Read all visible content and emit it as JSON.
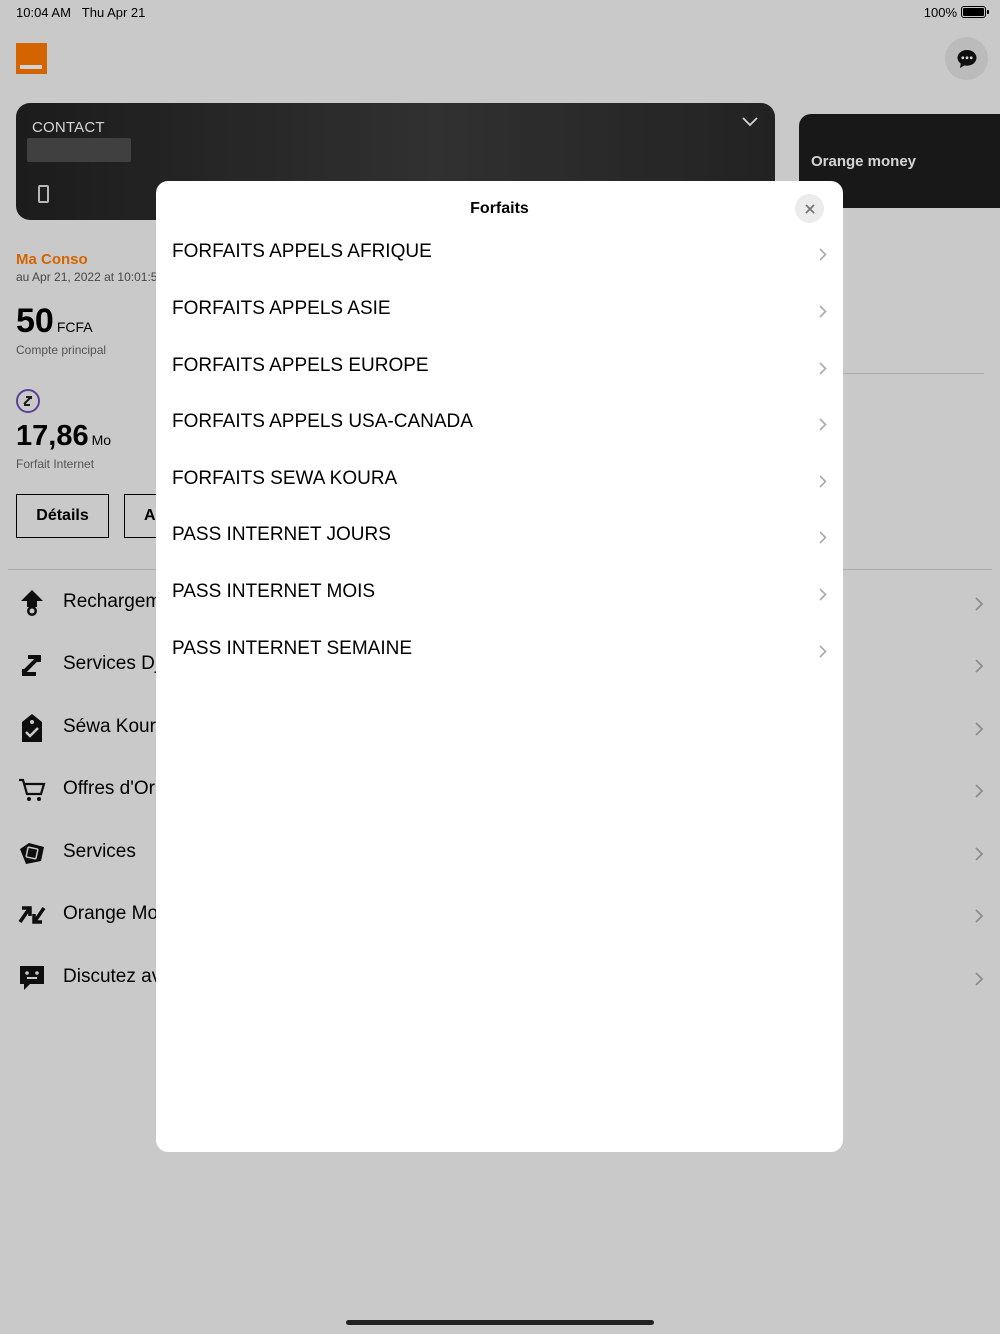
{
  "status_bar": {
    "time": "10:04 AM",
    "date": "Thu Apr 21",
    "battery": "100%"
  },
  "colors": {
    "brand_orange": "#ff7900",
    "djamo_purple": "#6e4fb4"
  },
  "header": {
    "logo_icon": "orange-logo",
    "chat_icon": "chat-bubble-icon"
  },
  "contact_card": {
    "label": "CONTACT"
  },
  "orange_money_card": {
    "label": "Orange money"
  },
  "conso": {
    "title": "Ma Conso",
    "date": "au Apr 21, 2022 at 10:01:5",
    "balance_value": "50",
    "balance_unit": "FCFA",
    "balance_label": "Compte principal",
    "data_value": "17,86",
    "data_unit": "Mo",
    "data_label": "Forfait Internet",
    "details_button": "Détails",
    "second_button": "A"
  },
  "menu": {
    "items": [
      {
        "label": "Rechargem",
        "icon": "recharge-arrow-icon"
      },
      {
        "label": "Services Dj",
        "icon": "djamo-icon"
      },
      {
        "label": "Séwa Koura",
        "icon": "shopping-bag-check-icon"
      },
      {
        "label": "Offres d'Or",
        "icon": "cart-icon"
      },
      {
        "label": "Services",
        "icon": "ticket-icon"
      },
      {
        "label": "Orange Mo",
        "icon": "arrows-exchange-icon"
      },
      {
        "label": "Discutez av",
        "icon": "chat-face-icon"
      }
    ]
  },
  "modal": {
    "title": "Forfaits",
    "items": [
      "FORFAITS APPELS AFRIQUE",
      "FORFAITS APPELS ASIE",
      "FORFAITS APPELS EUROPE",
      "FORFAITS APPELS USA-CANADA",
      "FORFAITS SEWA KOURA",
      "PASS INTERNET JOURS",
      "PASS INTERNET MOIS",
      "PASS INTERNET SEMAINE"
    ]
  }
}
